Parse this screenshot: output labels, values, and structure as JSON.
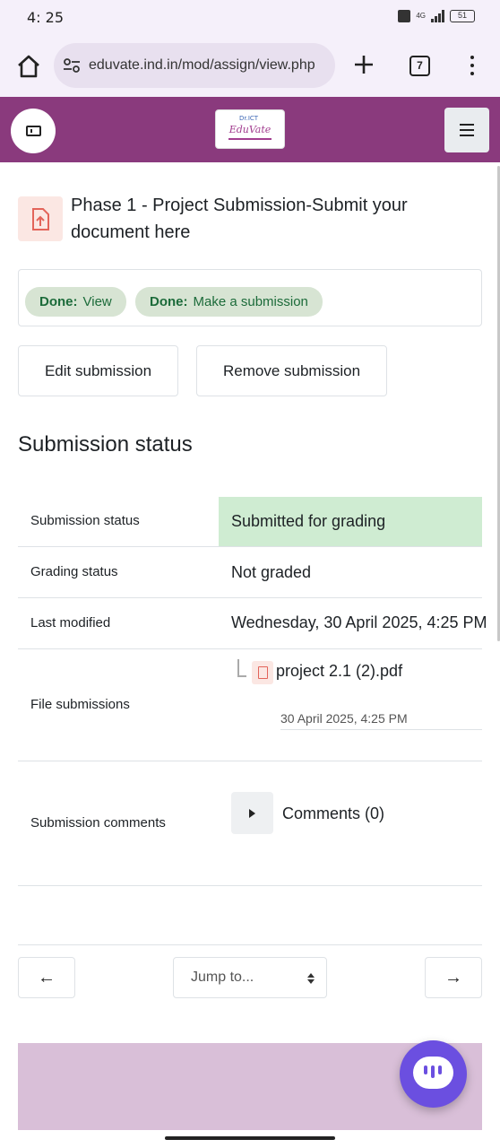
{
  "status_bar": {
    "time": "4: 25",
    "battery_label": "51"
  },
  "browser": {
    "url": "eduvate.ind.in/mod/assign/view.php",
    "tab_count": "7"
  },
  "site": {
    "logo_top": "Dr.ICT",
    "logo_name": "EduVate",
    "header_color": "#8a3a7d"
  },
  "activity": {
    "title": "Phase 1 - Project Submission-Submit your document here",
    "icon": "file-upload-icon"
  },
  "completion": {
    "items": [
      {
        "state": "Done:",
        "label": "View"
      },
      {
        "state": "Done:",
        "label": "Make a submission"
      }
    ]
  },
  "actions": {
    "edit_label": "Edit submission",
    "remove_label": "Remove submission"
  },
  "submission_status": {
    "heading": "Submission status",
    "rows": [
      {
        "label": "Submission status",
        "value": "Submitted for grading"
      },
      {
        "label": "Grading status",
        "value": "Not graded"
      },
      {
        "label": "Last modified",
        "value": "Wednesday, 30 April 2025, 4:25 PM"
      },
      {
        "label": "File submissions"
      },
      {
        "label": "Submission comments",
        "value": "Comments (0)"
      }
    ],
    "file": {
      "name": "project 2.1 (2).pdf",
      "date": "30 April 2025, 4:25 PM"
    }
  },
  "navigation": {
    "prev": "←",
    "jump_label": "Jump to...",
    "next": "→"
  }
}
